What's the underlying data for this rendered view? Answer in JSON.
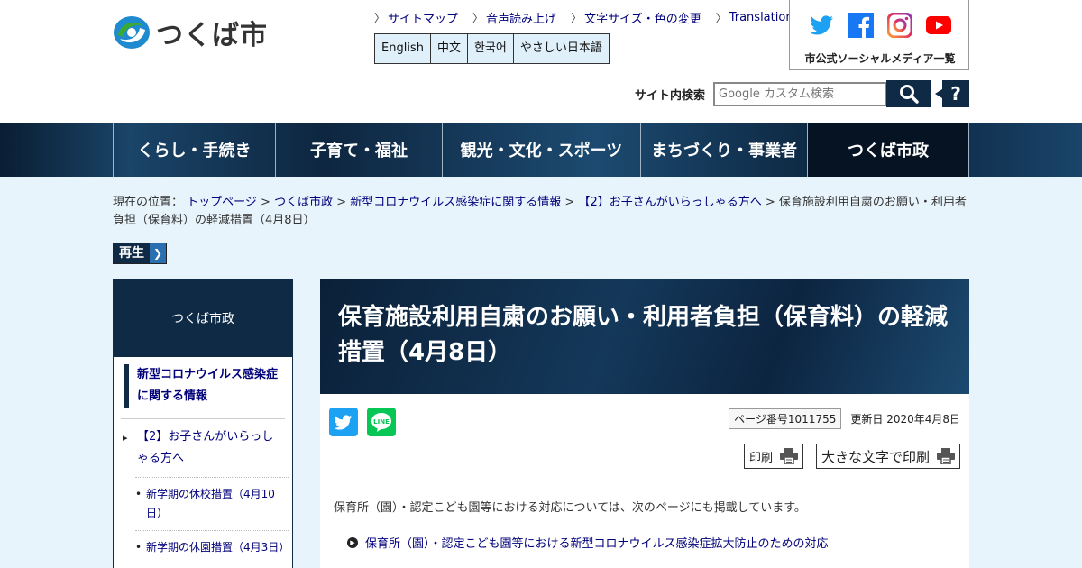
{
  "header": {
    "logo_text": "つくば市",
    "util_links": [
      "サイトマップ",
      "音声読み上げ",
      "文字サイズ・色の変更",
      "Translation"
    ],
    "languages": [
      "English",
      "中文",
      "한국어",
      "やさしい日本語"
    ],
    "social_label": "市公式ソーシャルメディア一覧",
    "search_label": "サイト内検索",
    "search_placeholder": "Google カスタム検索",
    "help_label": "?"
  },
  "nav": {
    "items": [
      "くらし・手続き",
      "子育て・福祉",
      "観光・文化・スポーツ",
      "まちづくり・事業者",
      "つくば市政"
    ]
  },
  "breadcrumb": {
    "prefix": "現在の位置：",
    "links": [
      "トップページ",
      "つくば市政",
      "新型コロナウイルス感染症に関する情報",
      "【2】お子さんがいらっしゃる方へ"
    ],
    "current": "保育施設利用自粛のお願い・利用者負担（保育料）の軽減措置（4月8日）"
  },
  "play_label": "再生",
  "sidebar": {
    "heading": "つくば市政",
    "current": "新型コロナウイルス感染症に関する情報",
    "level2": "【2】お子さんがいらっしゃる方へ",
    "level3": [
      "新学期の休校措置（4月10日）",
      "新学期の休園措置（4月3日）"
    ]
  },
  "main": {
    "title": "保育施設利用自粛のお願い・利用者負担（保育料）の軽減措置（4月8日）",
    "page_number": "ページ番号1011755",
    "updated": "更新日 2020年4月8日",
    "print_label": "印刷",
    "print_large_label": "大きな文字で印刷",
    "body_text": "保育所（園）・認定こども園等における対応については、次のページにも掲載しています。",
    "body_link": "保育所（園）・認定こども園等における新型コロナウイルス感染症拡大防止のための対応"
  },
  "colors": {
    "navy": "#0e2a45",
    "link": "#00007a",
    "page_bg": "#e8f4fc"
  }
}
